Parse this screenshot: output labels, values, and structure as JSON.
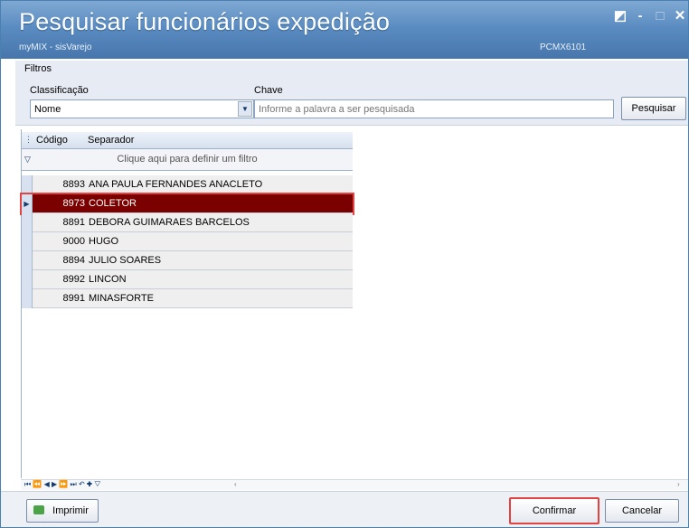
{
  "window": {
    "title": "Pesquisar funcionários expedição",
    "subtitle": "myMIX - sisVarejo",
    "code": "PCMX6101",
    "controls": [
      "restore-icon",
      "minimize-icon",
      "maximize-icon",
      "close-icon"
    ]
  },
  "filters": {
    "section_label": "Filtros",
    "classificacao_label": "Classificação",
    "classificacao_value": "Nome",
    "chave_label": "Chave",
    "chave_placeholder": "Informe a palavra a ser pesquisada",
    "pesquisar_label": "Pesquisar"
  },
  "grid": {
    "columns": [
      "Código",
      "Separador"
    ],
    "filter_hint": "Clique aqui para definir um filtro",
    "rows": [
      {
        "codigo": "8893",
        "separador": "ANA PAULA FERNANDES ANACLETO"
      },
      {
        "codigo": "8973",
        "separador": "COLETOR"
      },
      {
        "codigo": "8891",
        "separador": "DEBORA GUIMARAES BARCELOS"
      },
      {
        "codigo": "9000",
        "separador": "HUGO"
      },
      {
        "codigo": "8894",
        "separador": "JULIO SOARES"
      },
      {
        "codigo": "8992",
        "separador": "LINCON"
      },
      {
        "codigo": "8991",
        "separador": "MINASFORTE"
      }
    ],
    "selected_index": 1
  },
  "actions": {
    "imprimir": "Imprimir",
    "confirmar": "Confirmar",
    "cancelar": "Cancelar"
  },
  "colors": {
    "title_bar": "#5b8cc1",
    "selected_row": "#7b0000",
    "highlight": "#e24242"
  }
}
